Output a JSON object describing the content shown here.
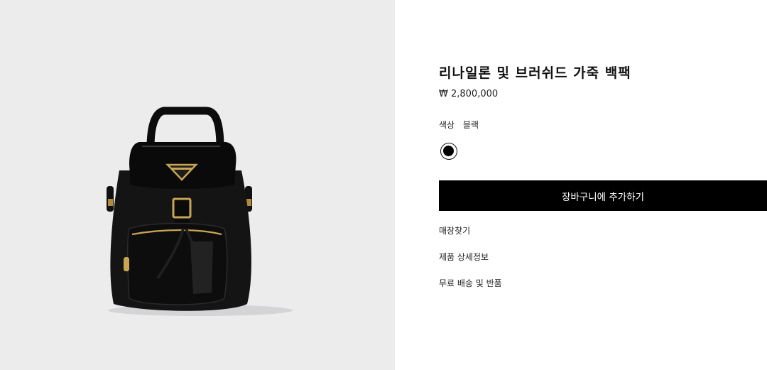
{
  "product": {
    "title": "리나일론 및 브러쉬드 가죽 백팩",
    "price": "₩ 2,800,000",
    "color_label": "색상",
    "color_value": "블랙",
    "swatch_color": "#000000"
  },
  "actions": {
    "add_to_cart": "장바구니에 추가하기"
  },
  "links": {
    "find_store": "매장찾기",
    "product_details": "제품 상세정보",
    "shipping_returns": "무료 배송 및 반품"
  },
  "colors": {
    "gallery_bg": "#ececed",
    "button_bg": "#000000",
    "button_text": "#ffffff"
  }
}
